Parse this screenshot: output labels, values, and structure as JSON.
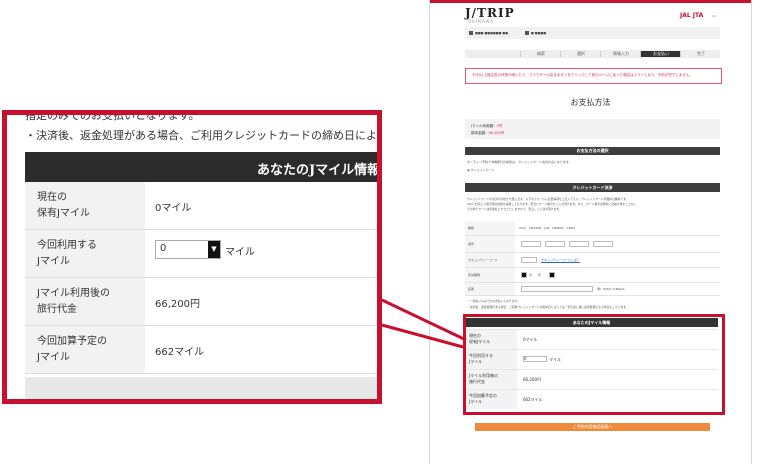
{
  "brand": {
    "logo": "J/TRIP",
    "logo_sub": "OKINAWA",
    "partner": "JAL JTA",
    "partner_sub": "JAL"
  },
  "infobar": {
    "items": [
      "■■■ ■■■■■■ ■■.",
      "■ ■■■■"
    ]
  },
  "steps": [
    {
      "label": "検索",
      "active": false
    },
    {
      "label": "選択",
      "active": false
    },
    {
      "label": "情報入力",
      "active": false
    },
    {
      "label": "お支払い",
      "active": true
    },
    {
      "label": "完了",
      "active": false
    }
  ],
  "alert": "30分以上無応答の状態が続いたり、ブラウザーの戻るボタンをクリックして前のページに戻った場合はエラーとなり、予約が完了しません。",
  "payment": {
    "title": "お支払方法",
    "used_miles_label": "Jマイル利用額：",
    "used_miles_value": "0円",
    "total_label": "請求金額：",
    "total_value": "66,200円"
  },
  "method_section": {
    "header": "お支払方法の選択",
    "note": "オンライン予約で沖縄旅行の場合は、クレジットカード決済のみとなります。",
    "option": "クレジットカード"
  },
  "card_section": {
    "header": "クレジットカード決済",
    "desc1": "クレジットカードの決済の手続きを致します。以下のフォームに必要事項をご記入下さい。クレジットカード手数料は無料です。",
    "desc2": "SSLに対応した暗号通信技術を採用しております。安全にカード番号をご入力頂けます。また、カード番号は弊社に記録を残すことなく",
    "desc3": "その場でカード決済会社とやりとりしますので、安心してご決済頂けます。",
    "rows": [
      {
        "label": "種類",
        "value": "VISA　MASTER　JCB　DINERS　AMEX"
      },
      {
        "label": "番号",
        "value": ""
      },
      {
        "label": "セキュリティーコード",
        "value": "セキュリティーコードとは？"
      },
      {
        "label": "有効期限",
        "value": "月　　年"
      },
      {
        "label": "名義",
        "value": "例）TARO YAMADA"
      }
    ],
    "foot1": "・一括払いのみでのお支払いとなります。",
    "foot2": "・決済後、返金処理がある場合、ご利用クレジットカードの締め日によっては一旦引落し後に返金処理となる場合もございます。"
  },
  "jmile": {
    "header": "あなたのJマイル情報",
    "rows": [
      {
        "label1": "現在の",
        "label2": "保有Jマイル",
        "value": "0マイル"
      },
      {
        "label1": "今回利用する",
        "label2": "Jマイル",
        "value": "0"
      },
      {
        "label1": "Jマイル利用後の",
        "label2": "旅行代金",
        "value": "66,200円"
      },
      {
        "label1": "今回加算予定の",
        "label2": "Jマイル",
        "value": "662マイル"
      }
    ],
    "select_value": "0",
    "unit": "マイル"
  },
  "zoom": {
    "top_cut": "指定のみでのお支払いとなります。",
    "note": "・決済後、返金処理がある場合、ご利用クレジットカードの締め日によっては一旦引"
  },
  "page_button": "ご予約内容確認画面へ",
  "colors": {
    "accent": "#c8102e",
    "header_dark": "#333333",
    "button_orange": "#f08a3c"
  }
}
